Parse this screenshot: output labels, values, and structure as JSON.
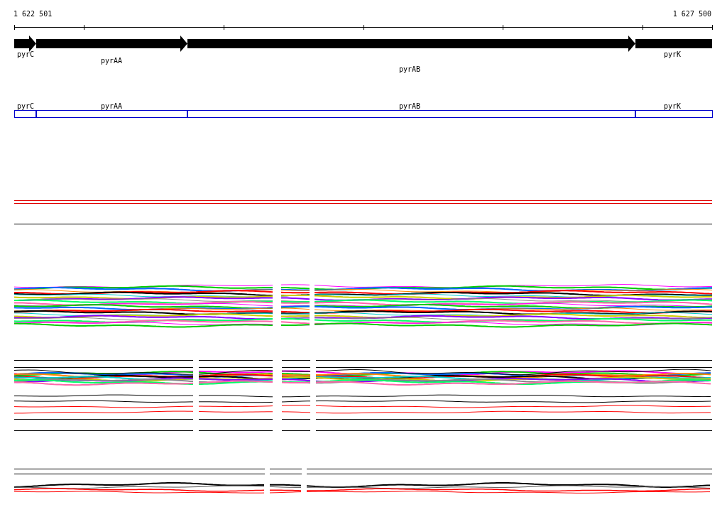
{
  "ruler": {
    "start_label": "1 622 501",
    "end_label": "1 627 500"
  },
  "gene_arrows": [
    {
      "name": "pyrC"
    },
    {
      "name": "pyrAA"
    },
    {
      "name": "pyrAB"
    },
    {
      "name": "pyrK"
    }
  ],
  "gene_boxes": [
    {
      "name": "pyrC"
    },
    {
      "name": "pyrAA"
    },
    {
      "name": "pyrAB"
    },
    {
      "name": "pyrK"
    }
  ]
}
